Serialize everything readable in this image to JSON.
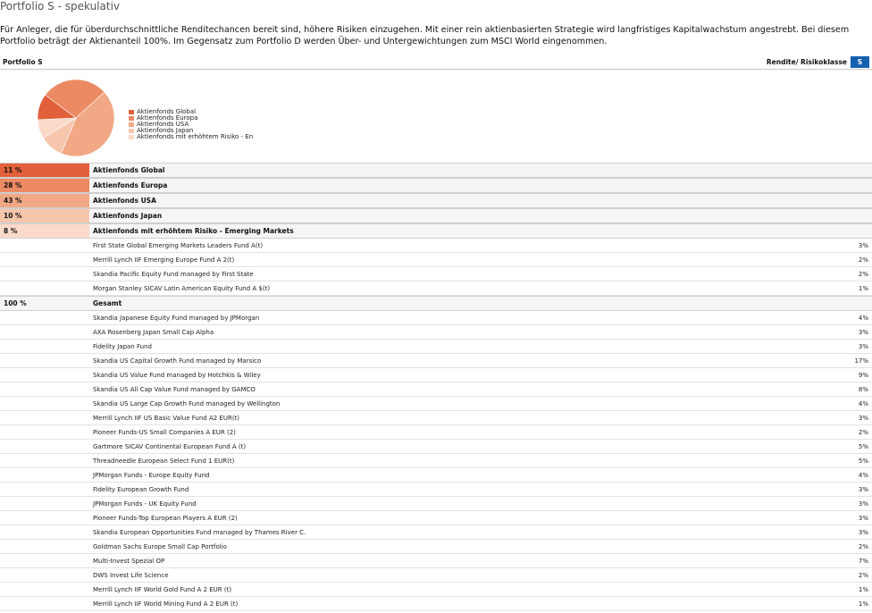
{
  "page": {
    "title": "Portfolio S - spekulativ",
    "description": "Für Anleger, die für überdurchschnittliche Renditechancen bereit sind, höhere Risiken einzugehen. Mit einer rein aktienbasierten Strategie wird langfristiges Kapitalwachstum angestrebt. Bei diesem Portfolio beträgt der Aktienanteil 100%. Im Gegensatz zum Portfolio D werden Über- und Untergewichtungen zum MSCI World eingenommen."
  },
  "header": {
    "portfolio_label": "Portfolio S",
    "risk_label": "Rendite/ Risikoklasse",
    "risk_value": "S"
  },
  "pie": {
    "legend": [
      "Aktienfonds Global",
      "Aktienfonds Europa",
      "Aktienfonds USA",
      "Aktienfonds Japan",
      "Aktienfonds mit erhöhtem Risiko - En"
    ],
    "slices": [
      {
        "value": 11,
        "color": "#e2603a"
      },
      {
        "value": 28,
        "color": "#ec8a63"
      },
      {
        "value": 43,
        "color": "#f2a885"
      },
      {
        "value": 10,
        "color": "#f6c6ac"
      },
      {
        "value": 8,
        "color": "#fad9c8"
      }
    ]
  },
  "categories": [
    {
      "pct": "11 %",
      "name": "Aktienfonds Global",
      "color": "#e2603a"
    },
    {
      "pct": "28 %",
      "name": "Aktienfonds Europa",
      "color": "#ec8a63"
    },
    {
      "pct": "43 %",
      "name": "Aktienfonds USA",
      "color": "#f2a885"
    },
    {
      "pct": "10 %",
      "name": "Aktienfonds Japan",
      "color": "#f6c6ac"
    },
    {
      "pct": "8 %",
      "name": "Aktienfonds mit erhöhtem Risiko - Emerging Markets",
      "color": "#fad9c8"
    }
  ],
  "funds_group1": [
    {
      "name": "First State Global Emerging Markets Leaders Fund A(t)",
      "pct": "3%"
    },
    {
      "name": "Merrill Lynch IIF Emerging Europe Fund A 2(t)",
      "pct": "2%"
    },
    {
      "name": "Skandia Pacific Equity Fund managed by First State",
      "pct": "2%"
    },
    {
      "name": "Morgan Stanley SICAV Latin American Equity Fund A $(t)",
      "pct": "1%"
    }
  ],
  "total": {
    "pct": "100 %",
    "name": "Gesamt"
  },
  "funds_group2": [
    {
      "name": "Skandia Japanese Equity Fund managed by JPMorgan",
      "pct": "4%"
    },
    {
      "name": "AXA Rosenberg Japan Small Cap Alpha",
      "pct": "3%"
    },
    {
      "name": "Fidelity Japan Fund",
      "pct": "3%"
    },
    {
      "name": "Skandia US Capital Growth Fund managed by Marsico",
      "pct": "17%"
    },
    {
      "name": "Skandia US Value Fund managed by Hotchkis & Wiley",
      "pct": "9%"
    },
    {
      "name": "Skandia US All Cap Value Fund managed by GAMCO",
      "pct": "8%"
    },
    {
      "name": "Skandia US Large Cap Growth Fund managed by Wellington",
      "pct": "4%"
    },
    {
      "name": "Merrill Lynch IIF US Basic Value Fund A2 EUR(t)",
      "pct": "3%"
    },
    {
      "name": "Pioneer Funds-US Small Companies A EUR (2)",
      "pct": "2%"
    },
    {
      "name": "Gartmore SICAV Continental European Fund A (t)",
      "pct": "5%"
    },
    {
      "name": "Threadneedle European Select Fund 1 EUR(t)",
      "pct": "5%"
    },
    {
      "name": "JPMorgan Funds - Europe Equity Fund",
      "pct": "4%"
    },
    {
      "name": "Fidelity European Growth Fund",
      "pct": "3%"
    },
    {
      "name": "JPMorgan Funds - UK Equity Fund",
      "pct": "3%"
    },
    {
      "name": "Pioneer Funds-Top European Players A EUR (2)",
      "pct": "3%"
    },
    {
      "name": "Skandia European Opportunities Fund managed by Thames River C.",
      "pct": "3%"
    },
    {
      "name": "Goldman Sachs Europe Small Cap Portfolio",
      "pct": "2%"
    },
    {
      "name": "Multi-Invest Spezial OP",
      "pct": "7%"
    },
    {
      "name": "DWS Invest Life Science",
      "pct": "2%"
    },
    {
      "name": "Merrill Lynch IIF World Gold Fund A 2 EUR (t)",
      "pct": "1%"
    },
    {
      "name": "Merrill Lynch IIF World Mining Fund A 2 EUR (t)",
      "pct": "1%"
    }
  ]
}
